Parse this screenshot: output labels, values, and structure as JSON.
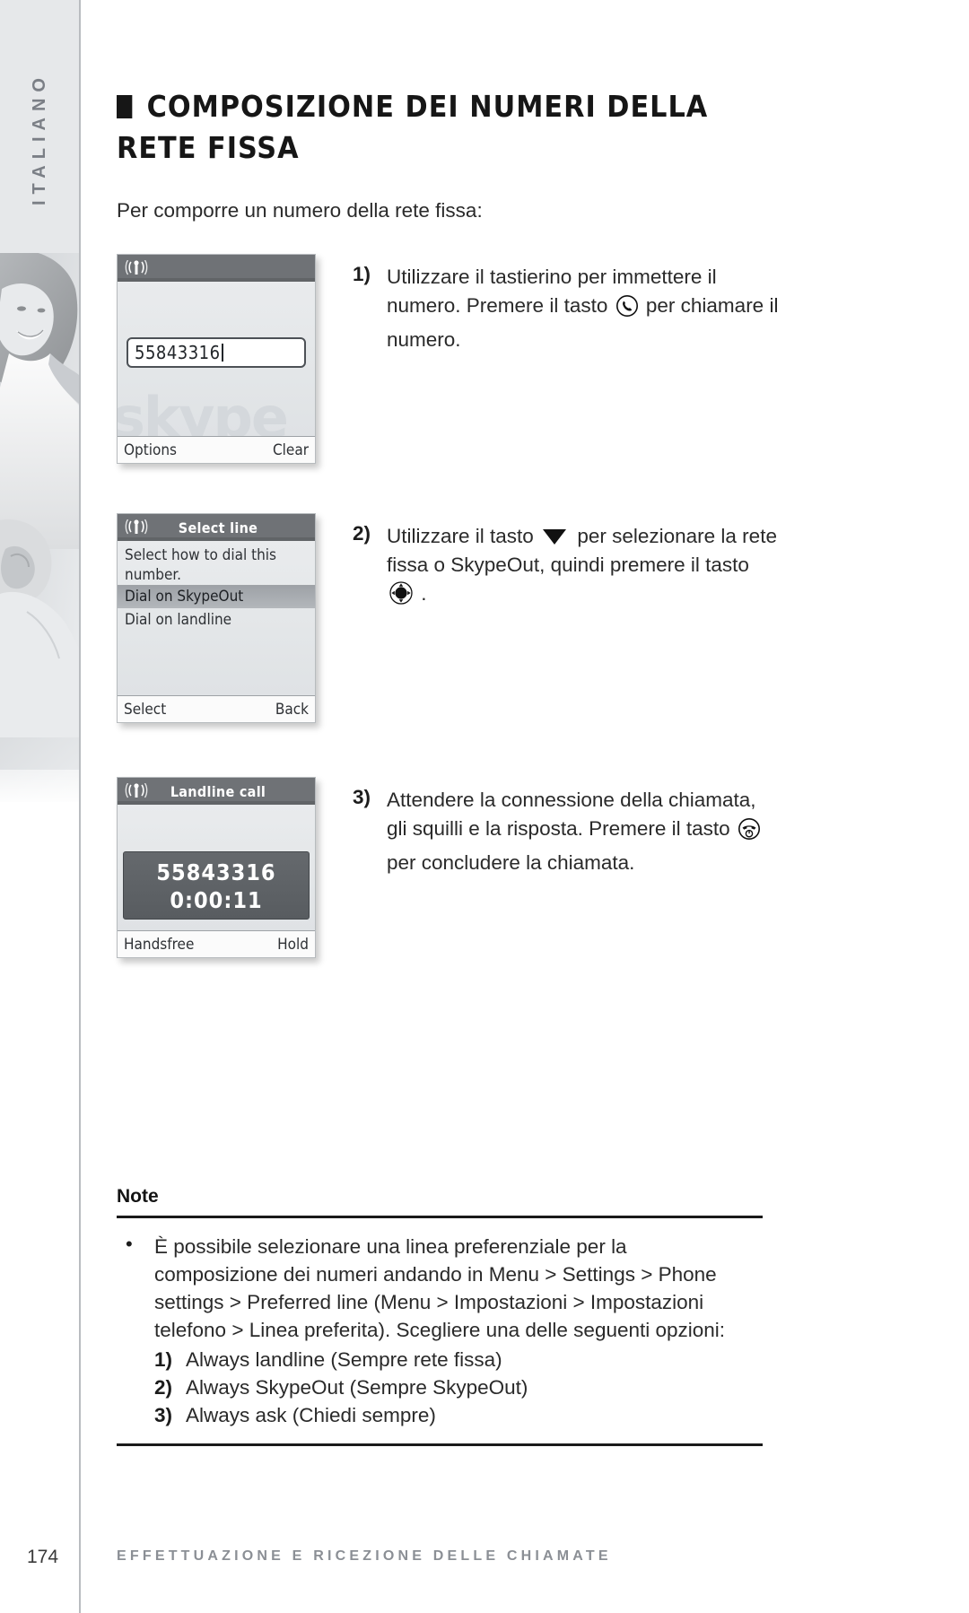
{
  "sidebar": {
    "language_tab": "ITALIANO",
    "photo_alt": "woman-smiling-photo"
  },
  "heading": {
    "bullet": "square-bullet",
    "title": "COMPOSIZIONE DEI NUMERI DELLA RETE FISSA"
  },
  "intro": "Per comporre un numero della rete fissa:",
  "steps": [
    {
      "number": "1)",
      "text_before": "Utilizzare il tastierino per immettere il numero. Premere il tasto",
      "icon": "call-button-icon",
      "text_after": "per chiamare il numero.",
      "screen": {
        "name": "dial-screen",
        "status_icon": "signal-antenna-icon",
        "title": "",
        "input_value": "55843316",
        "watermark": "skype",
        "softkey_left": "Options",
        "softkey_right": "Clear"
      }
    },
    {
      "number": "2)",
      "text_before": "Utilizzare il tasto",
      "icon": "down-arrow-key-icon",
      "text_mid": "per selezionare la rete fissa o SkypeOut, quindi premere il tasto",
      "icon2": "navigation-ok-key-icon",
      "text_after": ".",
      "screen": {
        "name": "select-line-screen",
        "status_icon": "signal-antenna-icon",
        "title": "Select line",
        "prompt": "Select how to dial this number.",
        "options": [
          "Dial on SkypeOut",
          "Dial on landline"
        ],
        "selected_index": 0,
        "softkey_left": "Select",
        "softkey_right": "Back"
      }
    },
    {
      "number": "3)",
      "text_before": "Attendere la connessione della chiamata, gli squilli e la risposta. Premere il tasto",
      "icon": "end-call-power-icon",
      "text_after": "per concludere la chiamata.",
      "screen": {
        "name": "landline-call-screen",
        "status_icon": "signal-antenna-icon",
        "title": "Landline call",
        "call_number": "55843316",
        "call_timer": "0:00:11",
        "softkey_left": "Handsfree",
        "softkey_right": "Hold"
      }
    }
  ],
  "note": {
    "heading": "Note",
    "bullet": "•",
    "paragraph": "È possibile selezionare una linea preferenziale per la composizione dei numeri andando in Menu > Settings > Phone settings > Preferred line (Menu > Impostazioni > Impostazioni telefono > Linea preferita). Scegliere una delle seguenti opzioni:",
    "options": [
      {
        "number": "1)",
        "label": "Always landline (Sempre rete fissa)"
      },
      {
        "number": "2)",
        "label": "Always SkypeOut (Sempre SkypeOut)"
      },
      {
        "number": "3)",
        "label": "Always ask (Chiedi sempre)"
      }
    ]
  },
  "footer": {
    "page_number": "174",
    "section_title": "EFFETTUAZIONE E RICEZIONE DELLE CHIAMATE"
  },
  "colors": {
    "sidebar_band": "#e6e8ea",
    "screen_title_bar": "#6f7276",
    "text": "#2a2a2a",
    "footer_text": "#8b8f95"
  }
}
